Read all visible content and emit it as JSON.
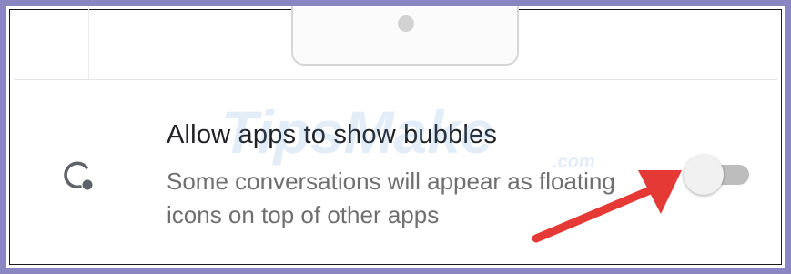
{
  "preview": {
    "image": "bubble-preview-illustration"
  },
  "setting": {
    "icon": "bubble-icon",
    "title": "Allow apps to show bubbles",
    "summary": "Some conversations will appear as floating icons on top of other apps",
    "toggle": {
      "state": "off",
      "track_color": "#bdbdbd",
      "thumb_color": "#f1f1f1"
    }
  },
  "watermark": {
    "text": "TipsMake",
    "suffix": ".com"
  },
  "annotation": {
    "type": "arrow",
    "color": "#e53935",
    "points_to": "toggle-switch"
  },
  "colors": {
    "frame_border": "#8a86c2",
    "title_text": "#202124",
    "summary_text": "#6f6f6f"
  }
}
